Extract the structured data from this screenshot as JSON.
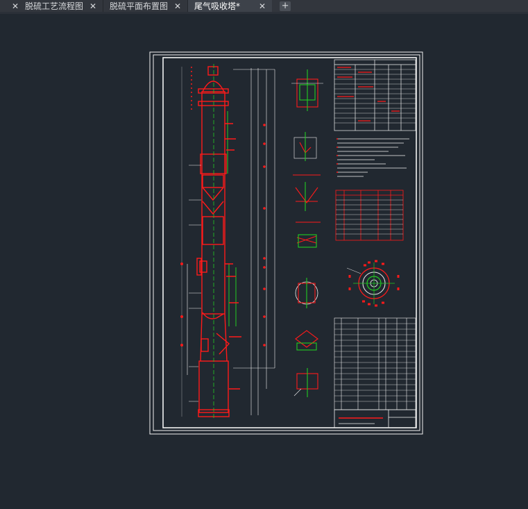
{
  "tabs": [
    {
      "label": "脱硫工艺流程图",
      "active": false
    },
    {
      "label": "脱硫平面布置图",
      "active": false
    },
    {
      "label": "尾气吸收塔*",
      "active": true
    }
  ],
  "icons": {
    "close": "✕",
    "new_tab": "+"
  },
  "colors": {
    "background": "#212830",
    "tab_bar": "#32363d",
    "drawing_white": "#f2f2f2",
    "drawing_red": "#ff1a1a",
    "drawing_green": "#22cc22"
  }
}
